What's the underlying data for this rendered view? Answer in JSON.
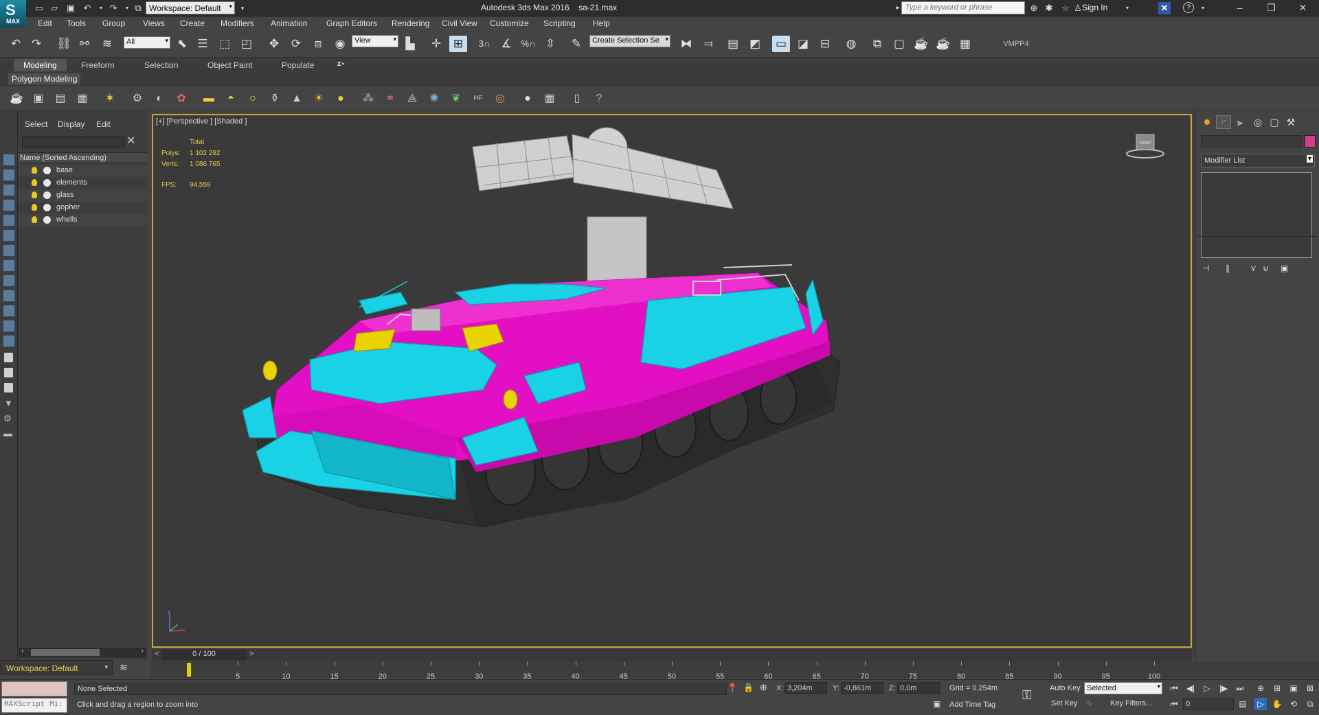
{
  "app": {
    "logo_text": "MAX",
    "workspace": "Workspace: Default",
    "title": "Autodesk 3ds Max 2016",
    "filename": "sa-21.max",
    "search_placeholder": "Type a keyword or phrase",
    "sign_in": "Sign In"
  },
  "menu": [
    "Edit",
    "Tools",
    "Group",
    "Views",
    "Create",
    "Modifiers",
    "Animation",
    "Graph Editors",
    "Rendering",
    "Civil View",
    "Customize",
    "Scripting",
    "Help"
  ],
  "toolbar": {
    "filter_value": "All",
    "ref_coord_value": "View",
    "named_selection_placeholder": "Create Selection Se",
    "snap_label": "3",
    "vmpp_label": "VMPP4"
  },
  "ribbon": {
    "tabs": [
      "Modeling",
      "Freeform",
      "Selection",
      "Object Paint",
      "Populate"
    ],
    "active_tab": "Modeling",
    "panel_label": "Polygon Modeling"
  },
  "scene_explorer": {
    "tabs": [
      "Select",
      "Display",
      "Edit"
    ],
    "column_header": "Name (Sorted Ascending)",
    "items": [
      "base",
      "elements",
      "glass",
      "gopher",
      "whells"
    ]
  },
  "viewport": {
    "label": "[+] [Perspective ] [Shaded ]",
    "stats": {
      "total_label": "Total",
      "polys_label": "Polys:",
      "polys_value": "1 102 292",
      "verts_label": "Verts:",
      "verts_value": "1 086 765",
      "fps_label": "FPS:",
      "fps_value": "94,559"
    },
    "model_colors": {
      "hull": "#e30fc4",
      "panels": "#19d2e6",
      "glass": "#e8d200",
      "tracks": "#2a2a2a",
      "launcher": "#c9c9c9"
    },
    "viewcube_label": "FRONT"
  },
  "command_panel": {
    "modifier_list": "Modifier List",
    "object_color": "#d63c8f"
  },
  "timeline": {
    "frame_display": "0 / 100",
    "ticks": [
      0,
      5,
      10,
      15,
      20,
      25,
      30,
      35,
      40,
      45,
      50,
      55,
      60,
      65,
      70,
      75,
      80,
      85,
      90,
      95,
      100
    ]
  },
  "status": {
    "workspace_bottom": "Workspace: Default",
    "maxscript_label": "MAXScript Mi:",
    "selection": "None Selected",
    "prompt": "Click and drag a region to zoom into",
    "x_label": "X:",
    "x_value": "3,204m",
    "y_label": "Y:",
    "y_value": "-0,861m",
    "z_label": "Z:",
    "z_value": "0,0m",
    "grid": "Grid = 0,254m",
    "add_time_tag": "Add Time Tag",
    "auto_key": "Auto Key",
    "set_key": "Set Key",
    "key_mode": "Selected",
    "key_filters": "Key Filters...",
    "frame": "0"
  }
}
